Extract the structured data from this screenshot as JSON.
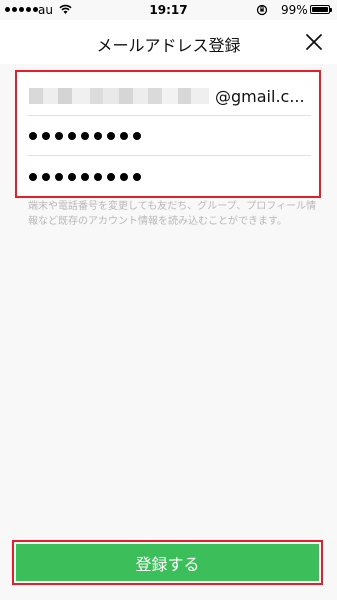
{
  "status_bar": {
    "carrier": "au",
    "time": "19:17",
    "battery": "99%",
    "battery_level": 0.99
  },
  "header": {
    "title": "メールアドレス登録",
    "close_icon": "close-icon"
  },
  "form": {
    "email_value_visible_part": "@gmail.c...",
    "password_masked": "●●●●●●●●●",
    "password_confirm_masked": "●●●●●●●●●"
  },
  "note": "端末や電話番号を変更しても友だち、グループ、プロフィール情報など既存のアカウント情報を読み込むことができます。",
  "submit": {
    "label": "登録する"
  },
  "colors": {
    "accent_green": "#3cbf5a",
    "highlight_red": "#e0202a",
    "note_gray": "#b8b8b8"
  }
}
